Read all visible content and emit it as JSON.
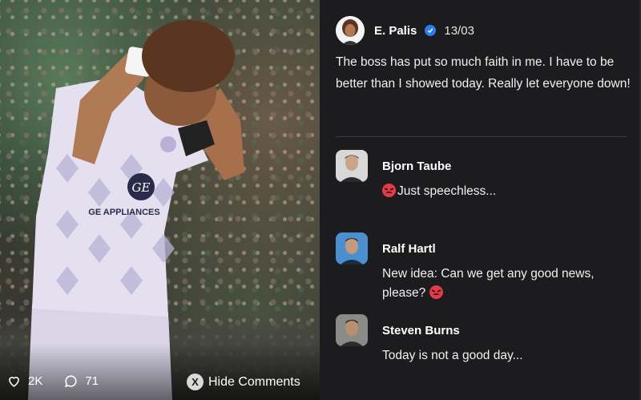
{
  "post": {
    "author": "E. Palis",
    "verified": true,
    "date": "13/03",
    "text": "The boss has put so much faith in me. I have to be better than I showed today. Really let everyone down!"
  },
  "media": {
    "sponsor_text": "GE APPLIANCES",
    "likes": "2K",
    "comments_count": "71",
    "hide_button_key": "X",
    "hide_button_label": "Hide Comments"
  },
  "comments": [
    {
      "name": "Bjorn Taube",
      "text": "Just speechless...",
      "emoji": "angry-face",
      "emoji_position": "before"
    },
    {
      "name": "Ralf Hartl",
      "text_line1": "New idea: Can we get any good news,",
      "text_line2": "please?",
      "emoji": "angry-face",
      "emoji_position": "after"
    },
    {
      "name": "Steven Burns",
      "text": "Today is not a good day..."
    }
  ],
  "colors": {
    "panel_bg": "#1c1c1e",
    "verified_badge": "#2b7de9",
    "angry_emoji": "#e23c4b"
  }
}
